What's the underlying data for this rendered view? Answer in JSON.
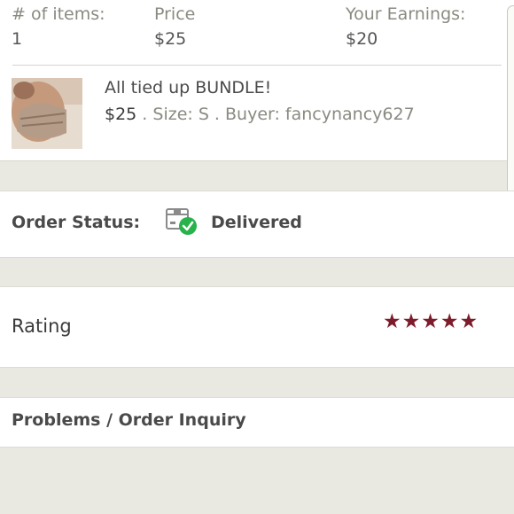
{
  "summary": {
    "items_header": "# of items:",
    "items_value": "1",
    "price_header": "Price",
    "price_value": "$25",
    "earnings_header": "Your Earnings:",
    "earnings_value": "$20"
  },
  "item": {
    "title": "All tied up BUNDLE!",
    "price": "$25",
    "meta": " . Size: S . Buyer: fancynancy627"
  },
  "order_status": {
    "label": "Order Status:",
    "value": "Delivered",
    "icon": "box-check-icon",
    "check_color": "#27b24a"
  },
  "rating": {
    "label": "Rating",
    "stars": "★★★★★",
    "star_value": 5,
    "star_color": "#7d1c2a"
  },
  "problems": {
    "label": "Problems / Order Inquiry"
  }
}
